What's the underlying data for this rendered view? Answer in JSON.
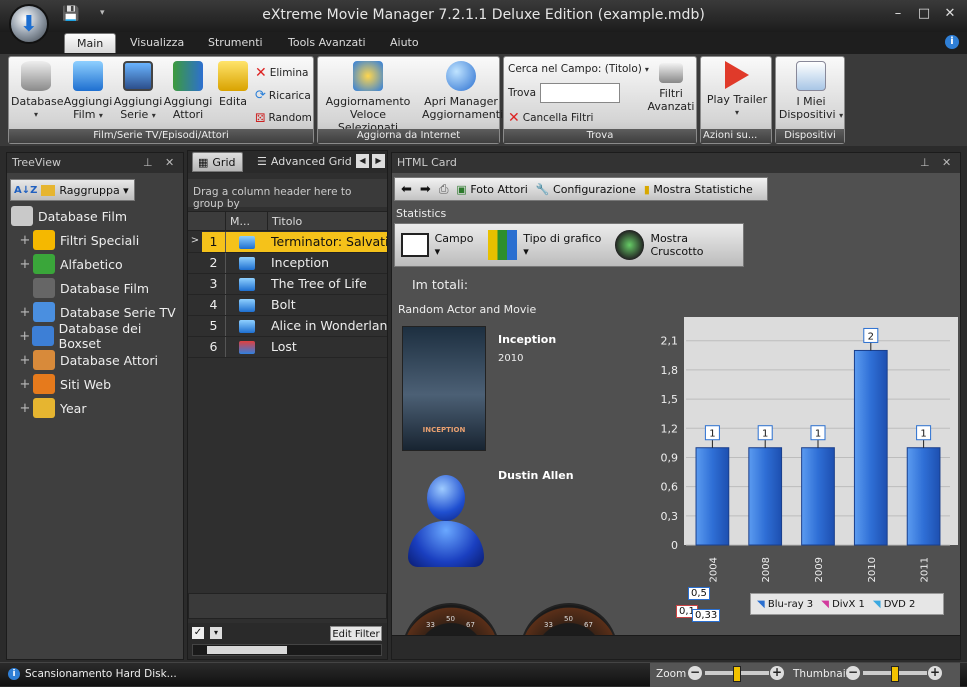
{
  "window": {
    "title": "eXtreme Movie Manager 7.2.1.1 Deluxe Edition (example.mdb)",
    "controls": {
      "min": "–",
      "max": "□",
      "close": "✕"
    }
  },
  "ribbon_tabs": [
    "Main",
    "Visualizza",
    "Strumenti",
    "Tools Avanzati",
    "Aiuto"
  ],
  "ribbon": {
    "group1": {
      "label": "Film/Serie TV/Episodi/Attori",
      "database": "Database",
      "aggiungi_film": [
        "Aggiungi",
        "Film"
      ],
      "aggiungi_serie": [
        "Aggiungi",
        "Serie"
      ],
      "aggiungi_attori": [
        "Aggiungi",
        "Attori"
      ],
      "edita": "Edita",
      "elimina": "Elimina",
      "ricarica": "Ricarica",
      "random": "Random"
    },
    "group2": {
      "label": "Aggiorna da Internet",
      "aggiornamento": [
        "Aggiornamento",
        "Veloce Selezionati"
      ],
      "manager": [
        "Apri Manager",
        "Aggiornamenti"
      ]
    },
    "group3": {
      "label": "Trova",
      "cerca": "Cerca nel Campo: (Titolo)",
      "trova": "Trova",
      "trova_value": "",
      "cancella": "Cancella Filtri",
      "filtri": [
        "Filtri",
        "Avanzati"
      ]
    },
    "group4": {
      "label": "Azioni su...",
      "play": "Play Trailer"
    },
    "group5": {
      "label": "Dispositivi",
      "dispositivi": [
        "I Miei",
        "Dispositivi"
      ]
    }
  },
  "treeview": {
    "title": "TreeView",
    "raggruppa": "Raggruppa",
    "nodes": [
      {
        "label": "Database Film",
        "expander": ""
      },
      {
        "label": "Filtri Speciali",
        "expander": "+"
      },
      {
        "label": "Alfabetico",
        "expander": "+"
      },
      {
        "label": "Database Film",
        "expander": ""
      },
      {
        "label": "Database Serie TV",
        "expander": "+"
      },
      {
        "label": "Database dei Boxset",
        "expander": "+"
      },
      {
        "label": "Database Attori",
        "expander": "+"
      },
      {
        "label": "Siti Web",
        "expander": "+"
      },
      {
        "label": "Year",
        "expander": "+"
      }
    ]
  },
  "grid": {
    "tab1": "Grid",
    "tab2": "Advanced Grid",
    "group_hint": "Drag a column header here to group by",
    "col_m": "M...",
    "col_title": "Titolo",
    "edit_filter": "Edit Filter",
    "rows": [
      {
        "n": "1",
        "title": "Terminator: Salvation"
      },
      {
        "n": "2",
        "title": "Inception"
      },
      {
        "n": "3",
        "title": "The Tree of Life"
      },
      {
        "n": "4",
        "title": "Bolt"
      },
      {
        "n": "5",
        "title": "Alice in Wonderland"
      },
      {
        "n": "6",
        "title": "Lost"
      }
    ]
  },
  "card": {
    "title": "HTML Card",
    "foto": "Foto Attori",
    "config": "Configurazione",
    "stats": "Mostra Statistiche",
    "statistics": "Statistics",
    "campo": "Campo",
    "tipo": "Tipo di grafico",
    "cruscotto": "Mostra Cruscotto",
    "totali": "Im totali:",
    "random": "Random Actor and Movie",
    "movie_title": "Inception",
    "movie_year": "2010",
    "poster_text": "INCEPTION",
    "actor": "Dustin Allen",
    "pie_labels": [
      "0,5",
      "0,1",
      "0,33"
    ],
    "legend": [
      "Blu-ray 3",
      "DivX 1",
      "DVD 2"
    ],
    "gauge_ticks": [
      "33",
      "50",
      "67"
    ]
  },
  "chart_data": {
    "type": "bar",
    "categories": [
      "2004",
      "2008",
      "2009",
      "2010",
      "2011"
    ],
    "values": [
      1,
      1,
      1,
      2,
      1
    ],
    "data_labels": [
      "1",
      "1",
      "1",
      "2",
      "1"
    ],
    "yticks": [
      "0",
      "0,3",
      "0,6",
      "0,9",
      "1,2",
      "1,5",
      "1,8",
      "2,1"
    ],
    "ylim": [
      0,
      2.2
    ],
    "color": "#2f6fd6"
  },
  "status": {
    "text": "Scansionamento Hard Disk...",
    "zoom": "Zoom",
    "thumb": "Thumbnail",
    "zoom_level": 0.5,
    "thumb_level": 0.5
  }
}
